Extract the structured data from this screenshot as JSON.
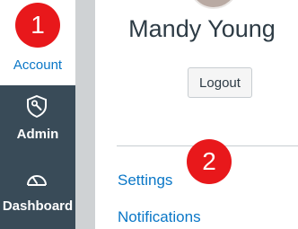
{
  "sidenav": {
    "account_label": "Account",
    "admin_label": "Admin",
    "dashboard_label": "Dashboard",
    "dark_color": "#394b58",
    "link_color": "#0a77c7"
  },
  "callouts": {
    "first": "1",
    "second": "2",
    "color": "#e8181b"
  },
  "tray": {
    "user_name": "Mandy Young",
    "logout_label": "Logout",
    "links": [
      {
        "label": "Settings"
      },
      {
        "label": "Notifications"
      }
    ]
  },
  "icons": {
    "admin": "admin-shield-icon",
    "dashboard": "dashboard-gauge-icon"
  }
}
